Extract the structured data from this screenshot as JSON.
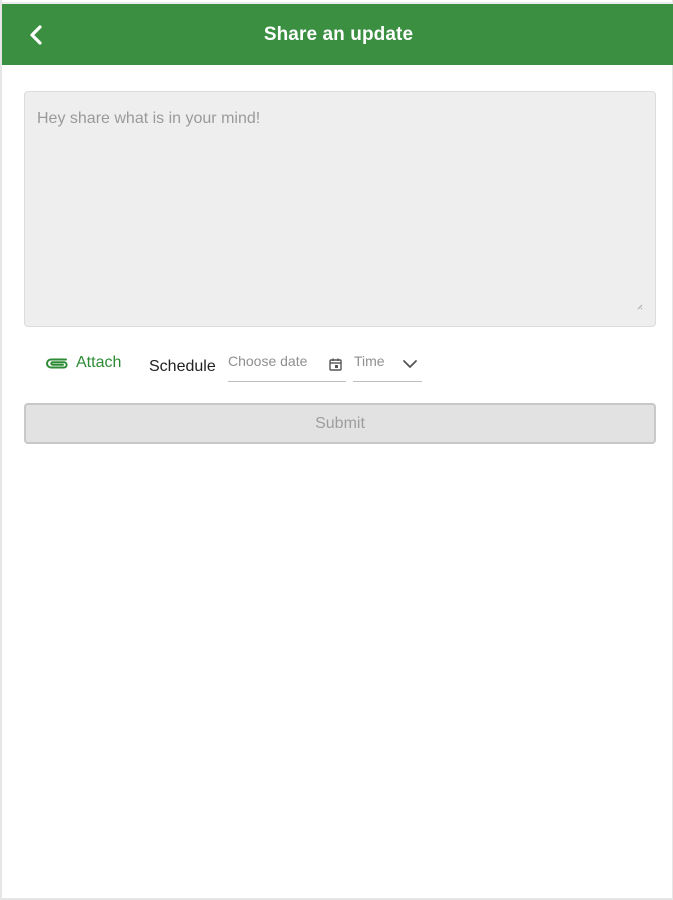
{
  "header": {
    "title": "Share an update",
    "back_icon": "chevron-left-icon",
    "background_color": "#3a8f40"
  },
  "composer": {
    "placeholder": "Hey share what is in your mind!",
    "value": ""
  },
  "options": {
    "attach_label": "Attach",
    "attach_icon": "paperclip-icon",
    "schedule_label": "Schedule",
    "date_placeholder": "Choose date",
    "date_icon": "calendar-icon",
    "time_label": "Time",
    "time_icon": "chevron-down-icon",
    "accent_color": "#2e8b35"
  },
  "submit": {
    "label": "Submit",
    "disabled": true
  }
}
